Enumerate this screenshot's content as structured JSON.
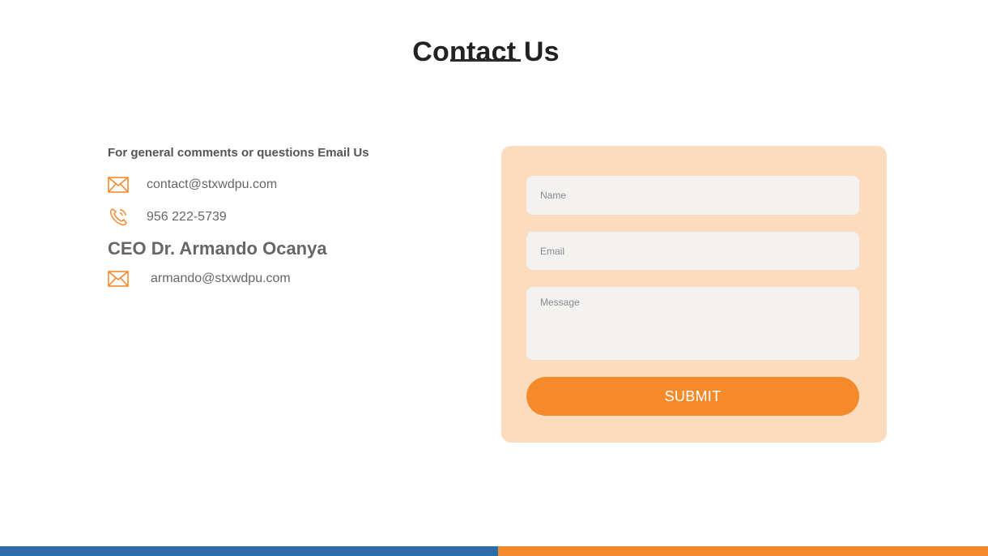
{
  "page": {
    "title": "Contact Us"
  },
  "info": {
    "heading": "For general comments or questions Email Us",
    "email": "contact@stxwdpu.com",
    "phone": "956 222-5739",
    "ceo_name": "CEO Dr. Armando Ocanya",
    "ceo_email": "armando@stxwdpu.com"
  },
  "form": {
    "name_placeholder": "Name",
    "email_placeholder": "Email",
    "message_placeholder": "Message",
    "submit_label": "SUBMIT"
  },
  "colors": {
    "accent_orange": "#f58a2b",
    "card_background": "#fbdcbe",
    "footer_blue": "#2d6ca8",
    "field_background": "#f3f2f1"
  },
  "icons": {
    "email": "envelope-icon",
    "phone": "phone-icon"
  }
}
